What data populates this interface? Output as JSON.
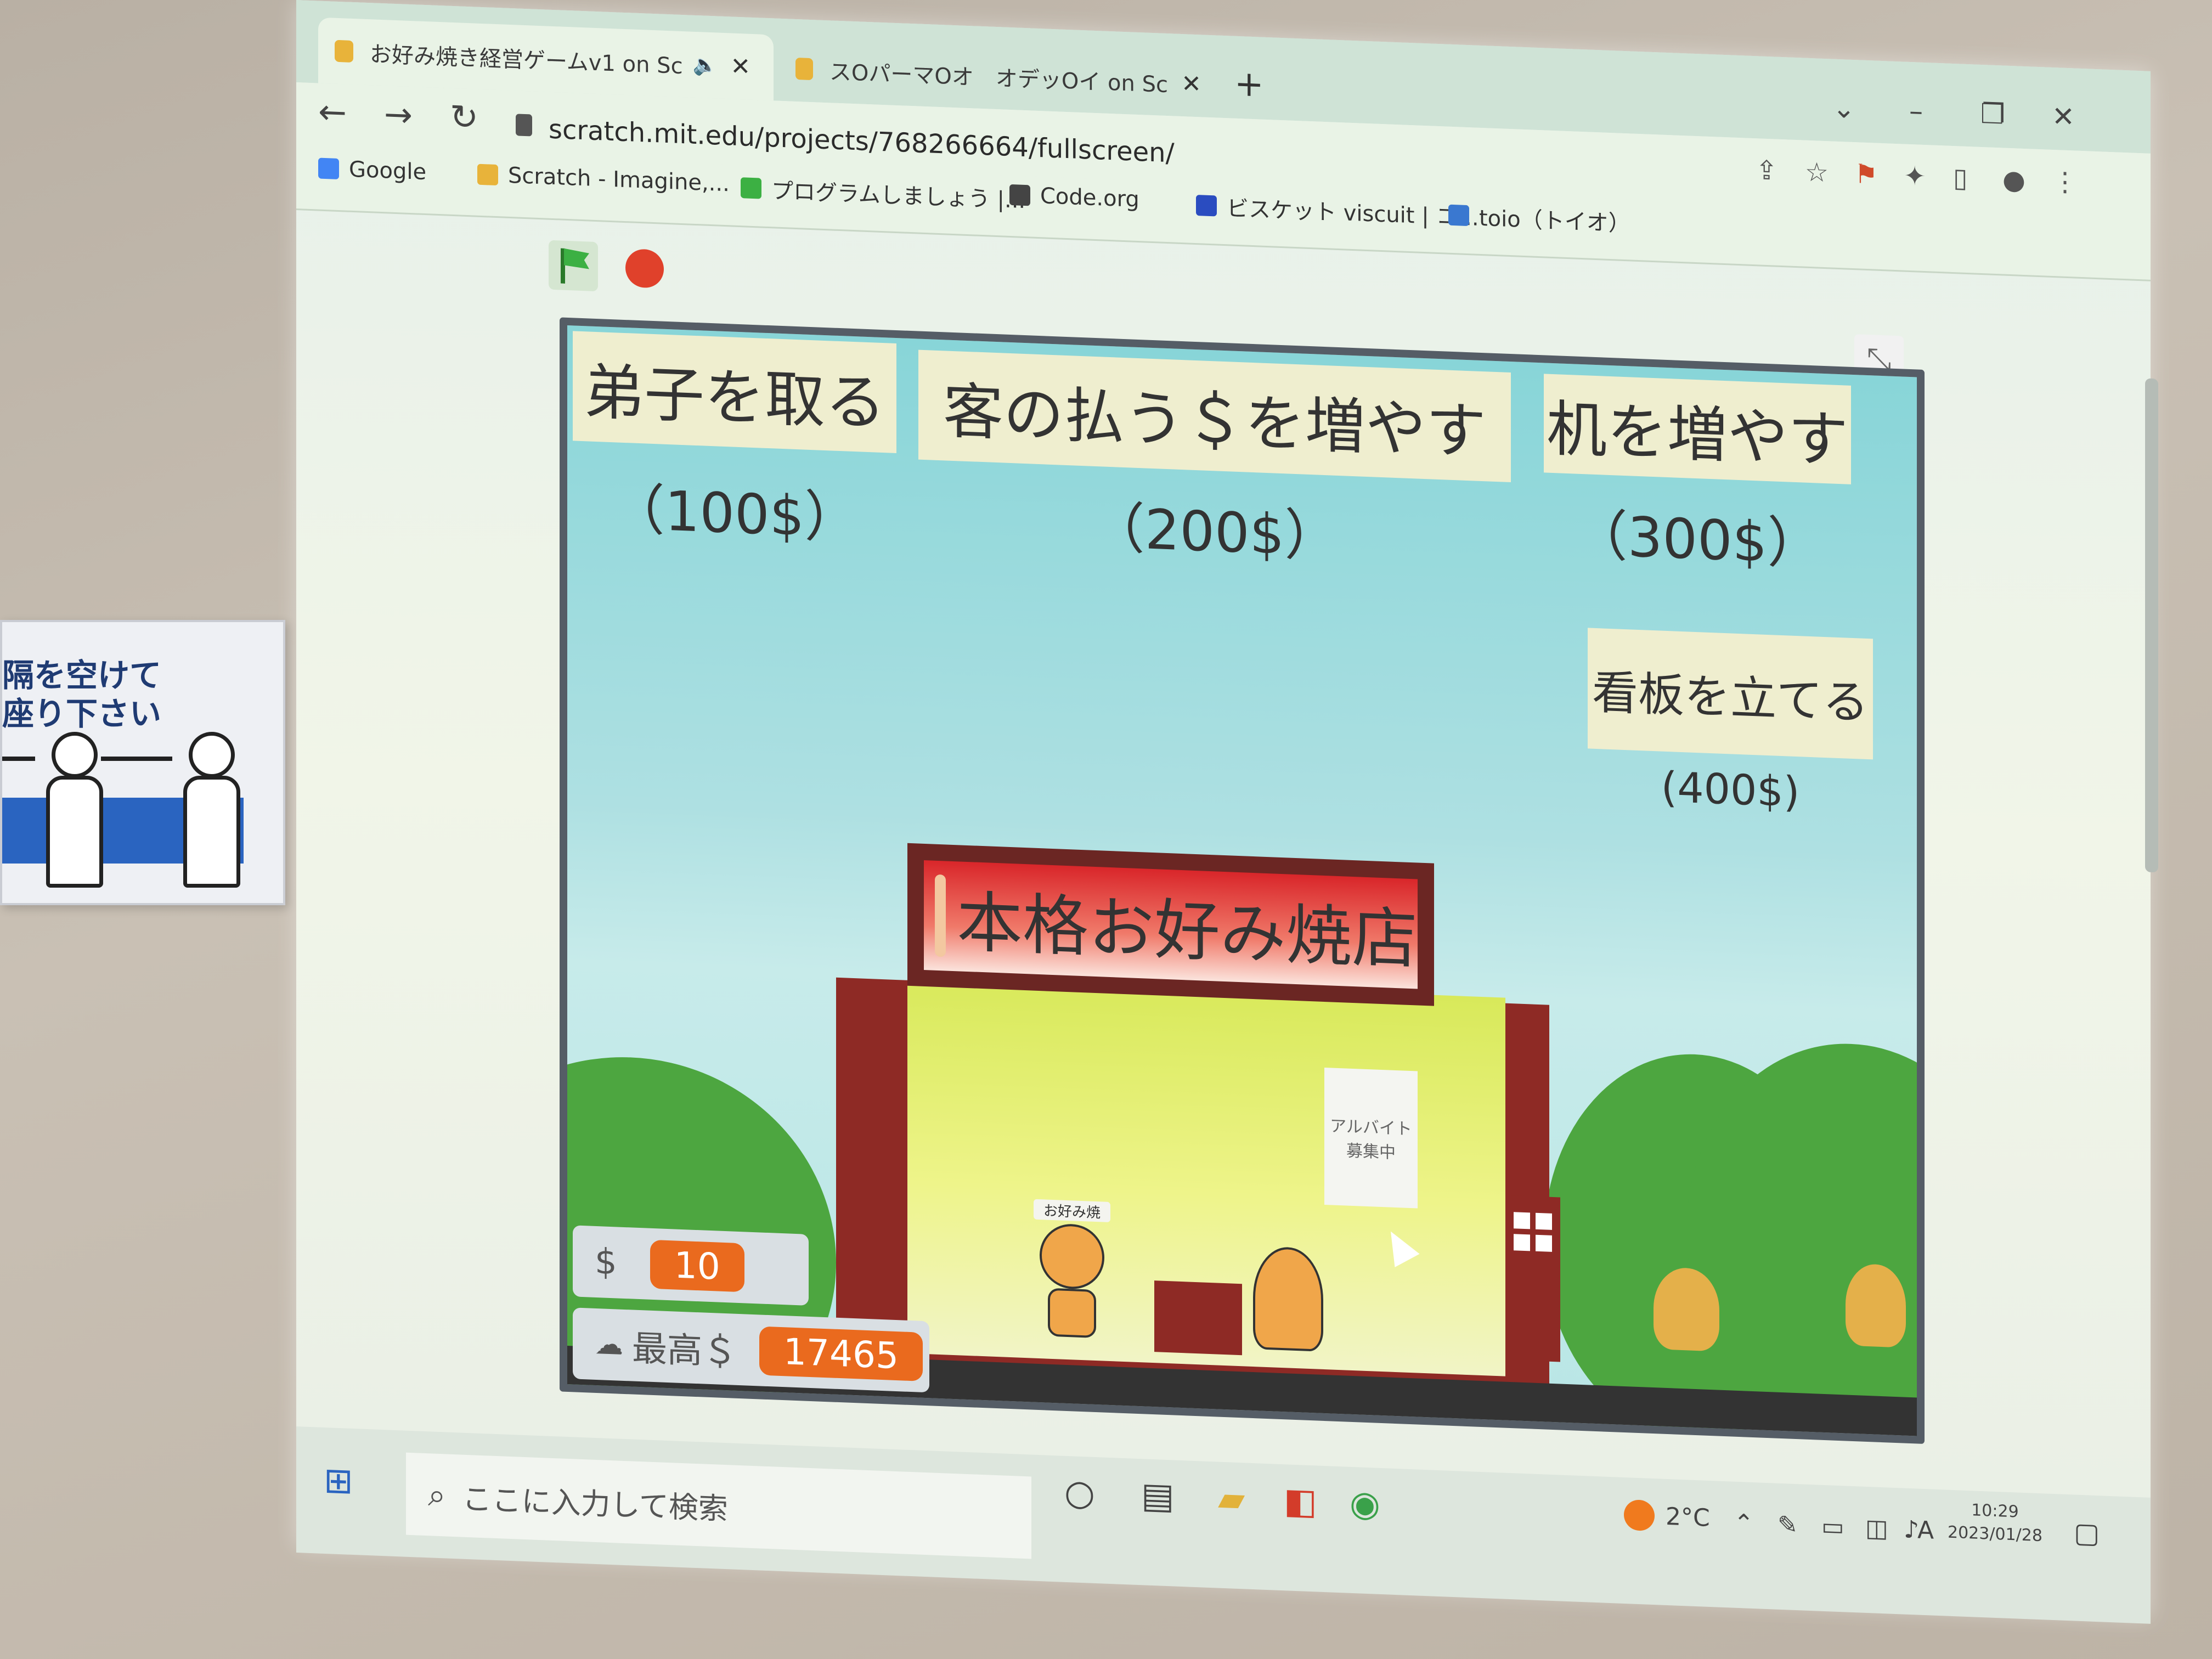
{
  "wall_sign": {
    "line1": "隔を空けて",
    "line2": "座り下さい"
  },
  "browser": {
    "tabs": [
      {
        "title": "お好み焼き経営ゲームv1 on Sc",
        "audio": "🔈",
        "close": "✕"
      },
      {
        "title": "スOパーマOオ　オデッOイ on Scra",
        "close": "✕"
      }
    ],
    "new_tab": "+",
    "window_controls": {
      "dropdown": "⌄",
      "minimize": "–",
      "restore": "❐",
      "close": "✕"
    },
    "nav": {
      "back": "←",
      "forward": "→",
      "reload": "↻"
    },
    "url": "scratch.mit.edu/projects/768266664/fullscreen/",
    "bookmarks": [
      {
        "label": "Google",
        "color": "#4285f4"
      },
      {
        "label": "Scratch - Imagine,...",
        "color": "#e8b33a"
      },
      {
        "label": "プログラムしましょう |...",
        "color": "#3cb043"
      },
      {
        "label": "Code.org",
        "color": "#444444"
      },
      {
        "label": "ビスケット viscuit | コ...",
        "color": "#2a4cc0"
      },
      {
        "label": "toio（トイオ）",
        "color": "#3a78d0"
      }
    ],
    "toolbar_icons": {
      "share": "⇪",
      "star": "☆",
      "ext": "⚑",
      "puzzle": "✦",
      "sidebar": "▯",
      "profile": "●",
      "menu": "⋮"
    }
  },
  "scratch": {
    "fullscreen_toggle": "⤡",
    "buttons": {
      "apprentice": {
        "label": "弟子を取る",
        "price": "（100$）"
      },
      "customer_pay": {
        "label": "客の払う＄を増やす",
        "price": "（200$）"
      },
      "tables": {
        "label": "机を増やす",
        "price": "（300$）"
      },
      "signboard": {
        "label": "看板を立てる",
        "price": "(400$)"
      }
    },
    "shop_sign": "本格お好み焼店",
    "notice": "アルバイト募集中",
    "cat_label": "お好み焼",
    "variables": {
      "money": {
        "label": "$",
        "value": "10"
      },
      "high_score": {
        "label": "最高＄",
        "value": "17465"
      }
    },
    "colors": {
      "accent_orange": "#ea6a1e",
      "shop_red": "#8e2a25",
      "sky": "#88d5d8",
      "hill": "#4da640"
    }
  },
  "taskbar": {
    "search_placeholder": "ここに入力して検索",
    "temperature": "2°C",
    "time": "10:29",
    "date": "2023/01/28",
    "ime": "A"
  }
}
